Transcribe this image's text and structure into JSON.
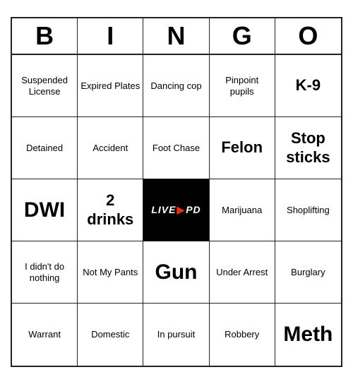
{
  "header": {
    "letters": [
      "B",
      "I",
      "N",
      "G",
      "O"
    ]
  },
  "grid": [
    [
      {
        "text": "Suspended License",
        "style": "normal"
      },
      {
        "text": "Expired Plates",
        "style": "normal"
      },
      {
        "text": "Dancing cop",
        "style": "normal"
      },
      {
        "text": "Pinpoint pupils",
        "style": "normal"
      },
      {
        "text": "K-9",
        "style": "large"
      }
    ],
    [
      {
        "text": "Detained",
        "style": "normal"
      },
      {
        "text": "Accident",
        "style": "normal"
      },
      {
        "text": "Foot Chase",
        "style": "normal"
      },
      {
        "text": "Felon",
        "style": "large"
      },
      {
        "text": "Stop sticks",
        "style": "large"
      }
    ],
    [
      {
        "text": "DWI",
        "style": "xl"
      },
      {
        "text": "2 drinks",
        "style": "large"
      },
      {
        "text": "LIVE PD",
        "style": "free"
      },
      {
        "text": "Marijuana",
        "style": "normal"
      },
      {
        "text": "Shoplifting",
        "style": "normal"
      }
    ],
    [
      {
        "text": "I didn't do nothing",
        "style": "normal"
      },
      {
        "text": "Not My Pants",
        "style": "normal"
      },
      {
        "text": "Gun",
        "style": "xl"
      },
      {
        "text": "Under Arrest",
        "style": "normal"
      },
      {
        "text": "Burglary",
        "style": "normal"
      }
    ],
    [
      {
        "text": "Warrant",
        "style": "normal"
      },
      {
        "text": "Domestic",
        "style": "normal"
      },
      {
        "text": "In pursuit",
        "style": "normal"
      },
      {
        "text": "Robbery",
        "style": "normal"
      },
      {
        "text": "Meth",
        "style": "xl"
      }
    ]
  ]
}
